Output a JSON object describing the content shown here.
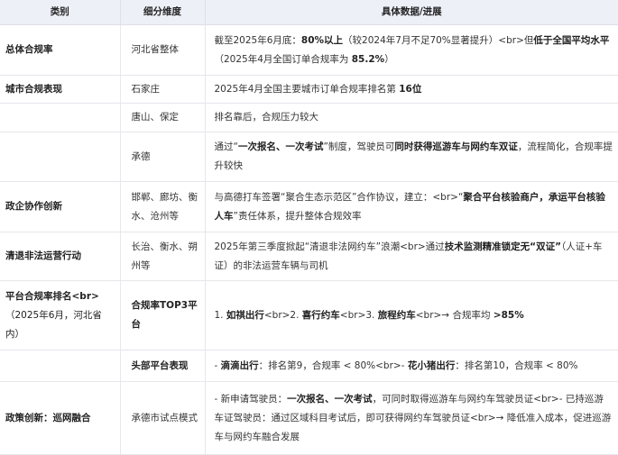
{
  "table": {
    "headers": [
      "类别",
      "细分维度",
      "具体数据/进展"
    ],
    "rows": [
      {
        "category": "总体合规率",
        "sub": "河北省整体",
        "detail": [
          {
            "t": "截至2025年6月底："
          },
          {
            "t": "80%以上",
            "b": true
          },
          {
            "t": "（较2024年7月不足70%显著提升）<br>但"
          },
          {
            "t": "低于全国平均水平",
            "b": true
          },
          {
            "t": "（2025年4月全国订单合规率为 "
          },
          {
            "t": "85.2%",
            "b": true
          },
          {
            "t": "）"
          }
        ]
      },
      {
        "category": "城市合规表现",
        "sub": "石家庄",
        "detail": [
          {
            "t": "2025年4月全国主要城市订单合规率排名第 "
          },
          {
            "t": "16位",
            "b": true
          }
        ]
      },
      {
        "category": "",
        "sub": "唐山、保定",
        "detail": [
          {
            "t": "排名靠后，合规压力较大"
          }
        ]
      },
      {
        "category": "",
        "sub": "承德",
        "detail": [
          {
            "t": "通过“"
          },
          {
            "t": "一次报名、一次考试",
            "b": true
          },
          {
            "t": "”制度，驾驶员可"
          },
          {
            "t": "同时获得巡游车与网约车双证",
            "b": true
          },
          {
            "t": "，流程简化，合规率提升较快"
          }
        ]
      },
      {
        "category": "政企协作创新",
        "sub": "邯郸、廊坊、衡水、沧州等",
        "detail": [
          {
            "t": "与高德打车签署“聚合生态示范区”合作协议，建立：<br>“"
          },
          {
            "t": "聚合平台核验商户，承运平台核验人车",
            "b": true
          },
          {
            "t": "”责任体系，提升整体合规效率"
          }
        ]
      },
      {
        "category": "清退非法运营行动",
        "sub": "长治、衡水、朔州等",
        "detail": [
          {
            "t": "2025年第三季度掀起“清退非法网约车”浪潮<br>通过"
          },
          {
            "t": "技术监测精准锁定无“双证”",
            "b": true
          },
          {
            "t": "（人证+车证）的非法运营车辆与司机"
          }
        ]
      },
      {
        "category": "平台合规率排名<br>",
        "category_extra": "（2025年6月，河北省内）",
        "sub": "合规率TOP3平台",
        "sub_bold": true,
        "detail": [
          {
            "t": "1. "
          },
          {
            "t": "如祺出行",
            "b": true
          },
          {
            "t": "<br>2. "
          },
          {
            "t": "喜行约车",
            "b": true
          },
          {
            "t": "<br>3. "
          },
          {
            "t": "旅程约车",
            "b": true
          },
          {
            "t": "<br>→ 合规率均 "
          },
          {
            "t": ">85%",
            "b": true
          }
        ]
      },
      {
        "category": "",
        "sub": "头部平台表现",
        "sub_bold": true,
        "detail": [
          {
            "t": "- "
          },
          {
            "t": "滴滴出行",
            "b": true
          },
          {
            "t": "：排名第9，合规率 < 80%<br>- "
          },
          {
            "t": "花小猪出行",
            "b": true
          },
          {
            "t": "：排名第10，合规率 < 80%"
          }
        ]
      },
      {
        "category": "政策创新：巡网融合",
        "sub": "承德市试点模式",
        "detail": [
          {
            "t": "- 新申请驾驶员："
          },
          {
            "t": "一次报名、一次考试",
            "b": true
          },
          {
            "t": "，可同时取得巡游车与网约车驾驶员证<br>- 已持巡游车证驾驶员：通过区域科目考试后，即可获得网约车驾驶员证<br>→ 降低准入成本，促进巡游车与网约车融合发展"
          }
        ]
      }
    ]
  }
}
